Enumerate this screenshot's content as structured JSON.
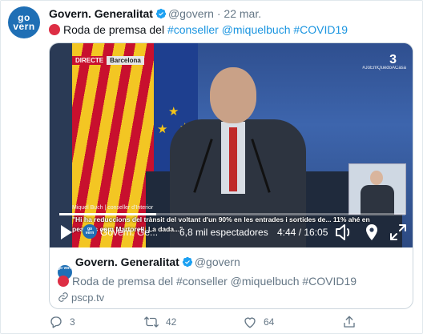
{
  "tweet": {
    "avatar_line1": "go",
    "avatar_line2": "vern",
    "display_name": "Govern. Generalitat",
    "handle": "@govern",
    "dot": "·",
    "date": "22 mar.",
    "text_prefix": "Roda de premsa del",
    "mention1": "#conseller",
    "mention2": "@miquelbuch",
    "hashtag": "#COVID19"
  },
  "video": {
    "badge_live": "DIRECTE",
    "badge_place": "Barcelona",
    "channel_logo": "3",
    "channel_hashtag": "#JoEmQuedoACasa",
    "lower_third": "Miquel Buch | conseller d'Interior",
    "subtitle": "\"Hi ha reduccions del trànsit del voltant d'un 90% en les entrades i sortides de... 11% ahé en peatges com Martorell. La dada...\"",
    "progress_fraction": 0.28,
    "controls": {
      "channel_avatar": "go vern",
      "channel_name": "Govern. Ge...",
      "viewers": "6,8 mil espectadores",
      "time": "4:44 / 16:05"
    }
  },
  "embed": {
    "avatar": "go vern",
    "display_name": "Govern. Generalitat",
    "handle": "@govern",
    "text": "Roda de premsa del #conseller @miquelbuch #COVID19",
    "link": "pscp.tv"
  },
  "actions": {
    "replies": "3",
    "retweets": "42",
    "likes": "64"
  },
  "colors": {
    "accent": "#1b95e0",
    "muted": "#657786",
    "avatar_blue": "#1f6fb5",
    "red_dot": "#dd2e44"
  }
}
